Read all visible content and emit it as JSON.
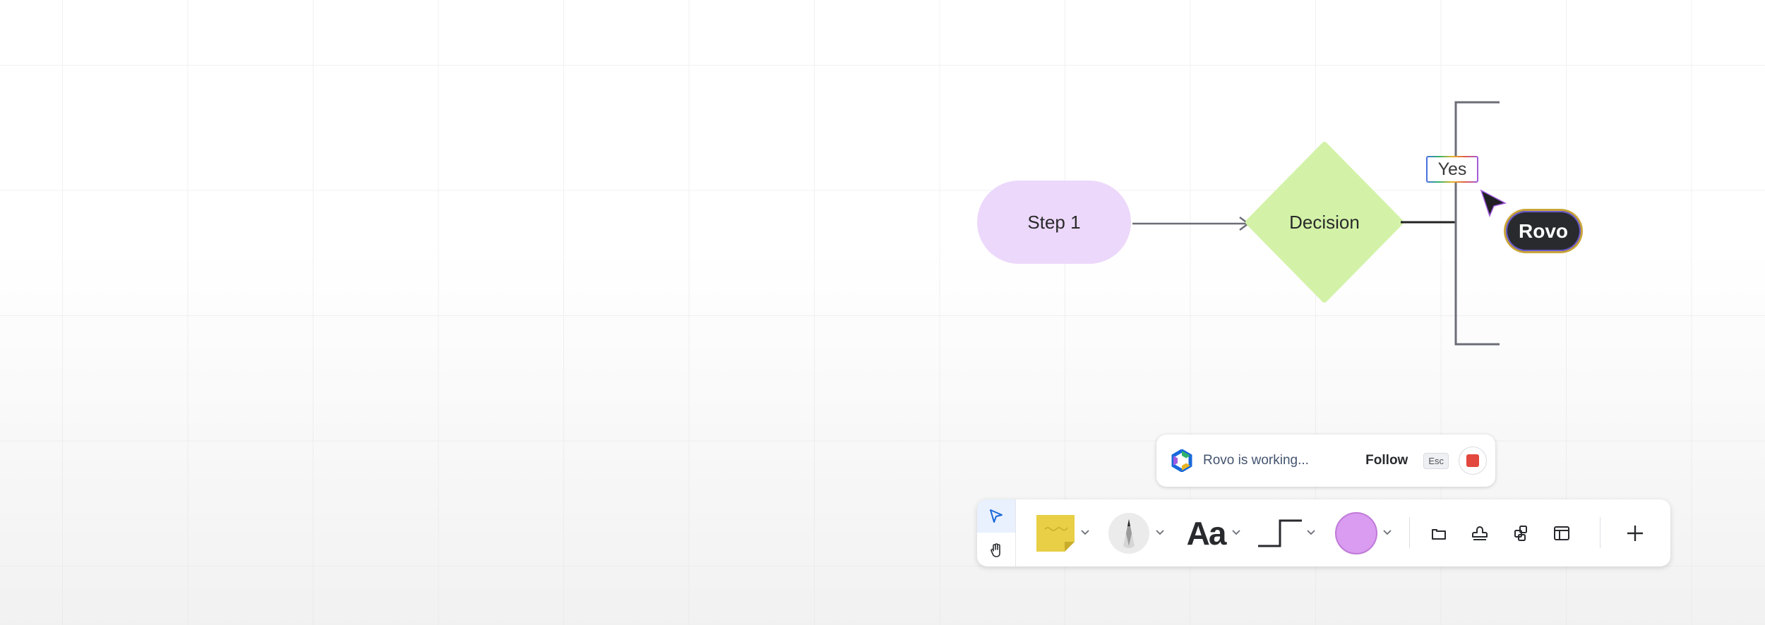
{
  "diagram": {
    "step1_label": "Step 1",
    "decision_label": "Decision",
    "yes_label": "Yes"
  },
  "cursor": {
    "user_label": "Rovo"
  },
  "status": {
    "text": "Rovo is working...",
    "follow_label": "Follow",
    "esc_label": "Esc"
  },
  "toolbar": {
    "text_tool_label": "Aa"
  },
  "colors": {
    "step1_fill": "#ecd8fb",
    "decision_fill": "#d3f2a8",
    "shape_tool_fill": "#d99cf0",
    "sticky_fill": "#e8cf45",
    "stop_red": "#e2483d",
    "select_blue": "#1868db"
  },
  "icons": {
    "select": "pointer-arrow-icon",
    "hand": "hand-icon",
    "sticky": "sticky-note-icon",
    "pen": "pen-icon",
    "connector": "elbow-connector-icon",
    "shape": "circle-shape-icon",
    "frame": "frame-icon",
    "stamp": "stamp-icon",
    "apps": "apps-icon",
    "template": "template-icon",
    "add": "plus-icon"
  }
}
